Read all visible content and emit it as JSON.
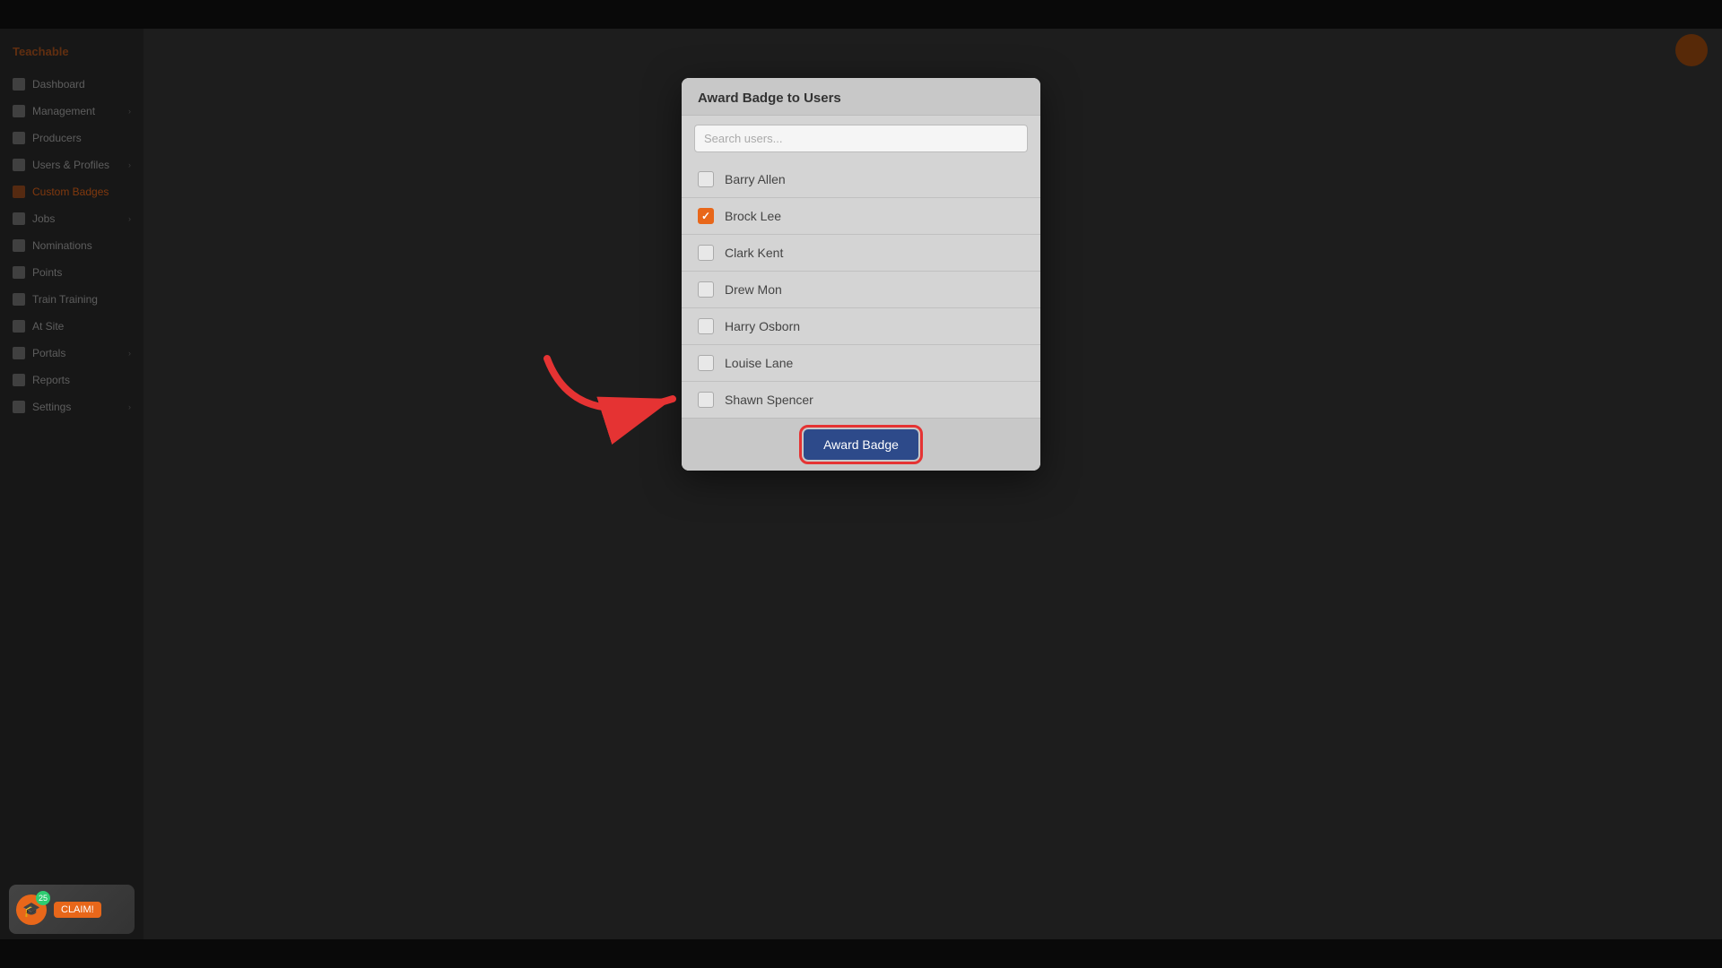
{
  "app": {
    "brand": "Teachable",
    "title": "Custom Badges"
  },
  "sidebar": {
    "items": [
      {
        "label": "Dashboard",
        "icon": "dashboard-icon",
        "active": false,
        "hasChevron": false
      },
      {
        "label": "Management",
        "icon": "management-icon",
        "active": false,
        "hasChevron": true
      },
      {
        "label": "Producers",
        "icon": "producers-icon",
        "active": false,
        "hasChevron": false
      },
      {
        "label": "Users & Profiles",
        "icon": "users-icon",
        "active": false,
        "hasChevron": true
      },
      {
        "label": "Custom Badges",
        "icon": "badges-icon",
        "active": true,
        "hasChevron": false
      },
      {
        "label": "Jobs",
        "icon": "jobs-icon",
        "active": false,
        "hasChevron": true
      },
      {
        "label": "Nominations",
        "icon": "nominations-icon",
        "active": false,
        "hasChevron": false
      },
      {
        "label": "Points",
        "icon": "points-icon",
        "active": false,
        "hasChevron": false
      },
      {
        "label": "Train Training",
        "icon": "training-icon",
        "active": false,
        "hasChevron": false
      },
      {
        "label": "At Site",
        "icon": "site-icon",
        "active": false,
        "hasChevron": false
      },
      {
        "label": "Portals",
        "icon": "portals-icon",
        "active": false,
        "hasChevron": true
      },
      {
        "label": "Reports",
        "icon": "reports-icon",
        "active": false,
        "hasChevron": false
      },
      {
        "label": "Settings",
        "icon": "settings-icon",
        "active": false,
        "hasChevron": true
      }
    ]
  },
  "modal": {
    "title": "Award Badge to Users",
    "search_placeholder": "Search users...",
    "users": [
      {
        "id": 1,
        "name": "Barry Allen",
        "checked": false
      },
      {
        "id": 2,
        "name": "Brock Lee",
        "checked": true
      },
      {
        "id": 3,
        "name": "Clark Kent",
        "checked": false
      },
      {
        "id": 4,
        "name": "Drew Mon",
        "checked": false
      },
      {
        "id": 5,
        "name": "Harry Osborn",
        "checked": false
      },
      {
        "id": 6,
        "name": "Louise Lane",
        "checked": false
      },
      {
        "id": 7,
        "name": "Shawn Spencer",
        "checked": false
      }
    ],
    "award_button_label": "Award Badge"
  },
  "notification": {
    "badge_count": "25",
    "action_label": "CLAIM!"
  }
}
